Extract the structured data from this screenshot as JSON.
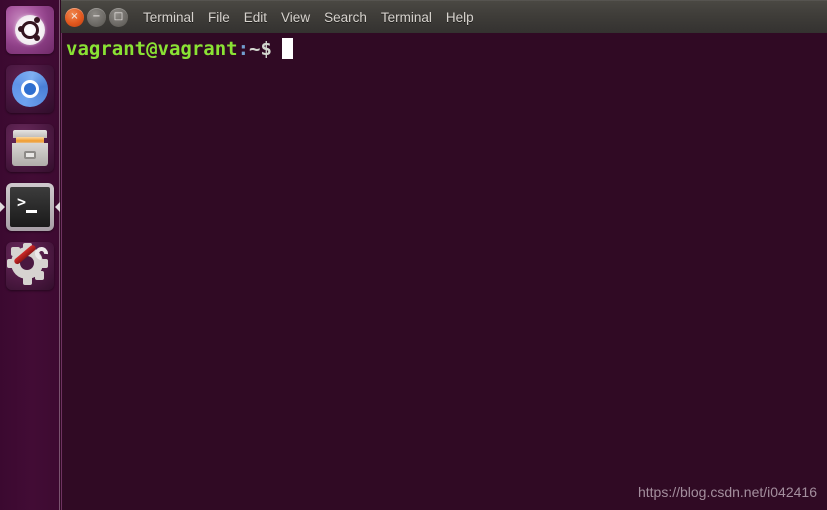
{
  "launcher": {
    "items": [
      {
        "name": "ubuntu-dash",
        "label": "Ubuntu Dash",
        "active": false
      },
      {
        "name": "chromium",
        "label": "Chromium Web Browser",
        "active": false
      },
      {
        "name": "files",
        "label": "Files",
        "active": false
      },
      {
        "name": "terminal",
        "label": "Terminal",
        "active": true
      },
      {
        "name": "system-settings",
        "label": "System Settings",
        "active": false
      }
    ]
  },
  "window": {
    "buttons": {
      "close": "×",
      "minimize": "−",
      "maximize": "□"
    },
    "menu": [
      {
        "label": "Terminal"
      },
      {
        "label": "File"
      },
      {
        "label": "Edit"
      },
      {
        "label": "View"
      },
      {
        "label": "Search"
      },
      {
        "label": "Terminal"
      },
      {
        "label": "Help"
      }
    ]
  },
  "terminal": {
    "prompt": {
      "user_host": "vagrant@vagrant",
      "separator": ":",
      "path": "~",
      "sigil": "$"
    },
    "command": "",
    "colors": {
      "background": "#300a24",
      "user_host": "#8ae234",
      "separator": "#729fcf",
      "path_sigil": "#d3d7cf",
      "cursor": "#ffffff"
    }
  },
  "watermark": {
    "text": "https://blog.csdn.net/i042416"
  }
}
